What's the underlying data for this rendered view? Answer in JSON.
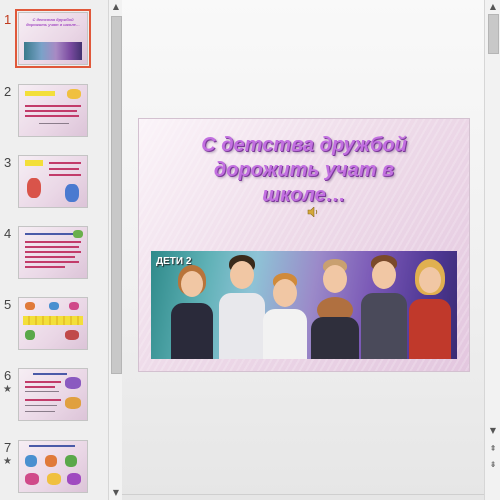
{
  "thumbnails": {
    "slides": [
      {
        "number": "1",
        "title": "С детства дружбой дорожить учат в школе…",
        "selected": true,
        "animated": false
      },
      {
        "number": "2",
        "animated": false
      },
      {
        "number": "3",
        "animated": false
      },
      {
        "number": "4",
        "animated": false
      },
      {
        "number": "5",
        "animated": false
      },
      {
        "number": "6",
        "animated": true,
        "star": "★"
      },
      {
        "number": "7",
        "animated": true,
        "star": "★"
      }
    ]
  },
  "slide": {
    "title": "С детства дружбой\nдорожить учат в\nшколе…",
    "photo_caption": "ДЕТИ 2",
    "audio_icon": "speaker-icon"
  },
  "colors": {
    "title": "#c26fe0",
    "selection": "#e0583a"
  },
  "scroll": {
    "up": "▲",
    "down": "▼",
    "prev": "⇞",
    "next": "⇟"
  }
}
